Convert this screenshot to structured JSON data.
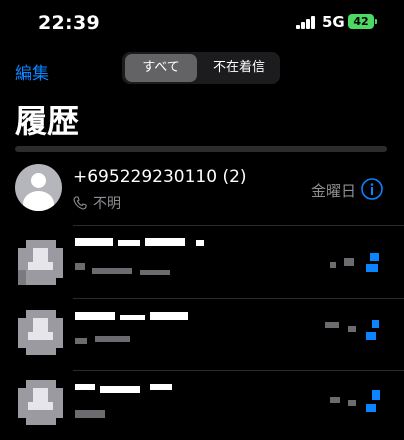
{
  "status_bar": {
    "time": "22:39",
    "network": "5G",
    "battery": "42"
  },
  "nav": {
    "edit_label": "編集",
    "segments": [
      "すべて",
      "不在着信"
    ],
    "selected_segment": "すべて"
  },
  "title": "履歴",
  "calls": [
    {
      "caller": "+695229230110 (2)",
      "type_label": "不明",
      "date": "金曜日",
      "icon": "phone-icon"
    }
  ],
  "colors": {
    "accent": "#0a84ff",
    "battery": "#4cd964",
    "secondary_text": "#8e8e93"
  }
}
